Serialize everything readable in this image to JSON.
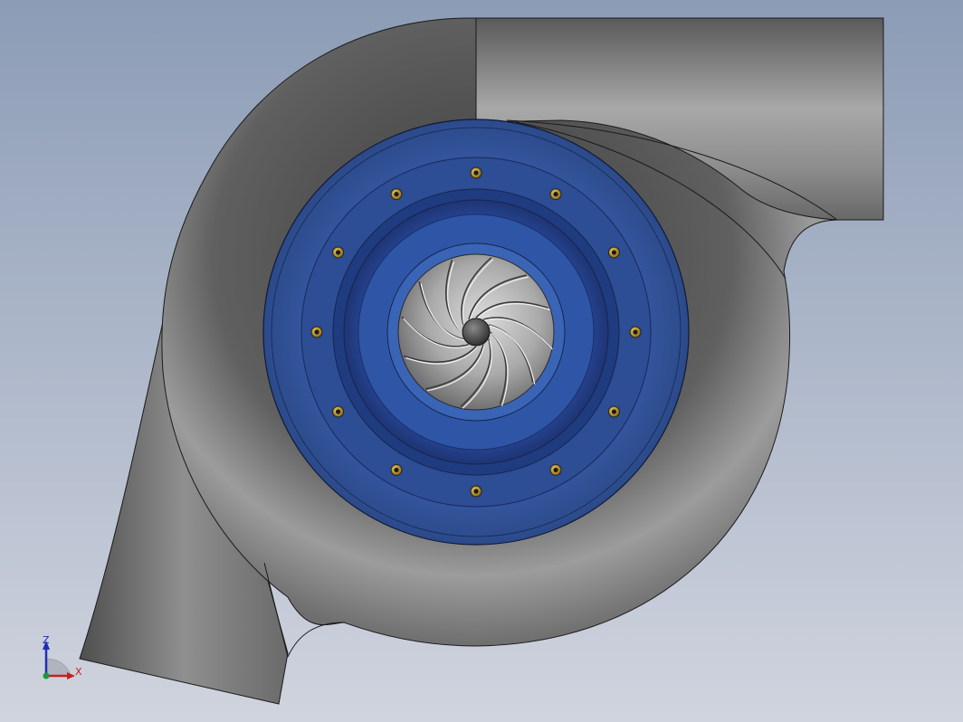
{
  "viewport": {
    "background_top": "#8c9cb6",
    "background_bottom": "#d0d4de"
  },
  "model": {
    "housing_color": "#8a8a8a",
    "flange_color": "#2e4f94",
    "bolt_count": 12,
    "impeller_blade_count": 12
  },
  "triad": {
    "x_label": "X",
    "z_label": "Z",
    "x_color": "#c81e1e",
    "z_color": "#1e2fb4",
    "origin_color": "#1a9a3a"
  }
}
